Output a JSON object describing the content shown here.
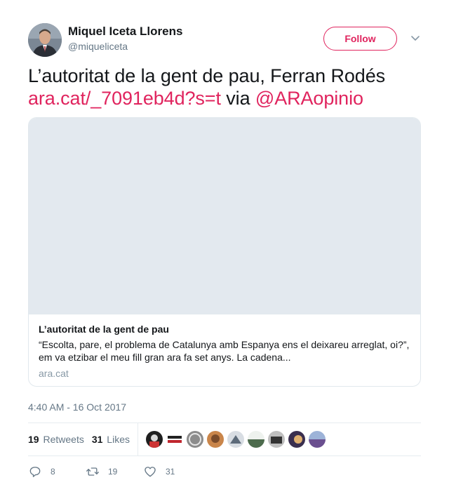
{
  "user": {
    "full_name": "Miquel Iceta Llorens",
    "handle": "@miqueliceta",
    "avatar_icon": "profile-photo"
  },
  "follow_label": "Follow",
  "tweet": {
    "text_plain": "L’autoritat de la gent de pau, Ferran Rodés",
    "link": "ara.cat/_7091eb4d?s=t",
    "via": "via",
    "mention": "@ARAopinio"
  },
  "card": {
    "title": "L’autoritat de la gent de pau",
    "description": "“Escolta, pare, el problema de Catalunya amb Espanya ens el deixareu arreglat, oi?”, em va etzibar el meu fill gran ara fa set anys. La cadena...",
    "domain": "ara.cat"
  },
  "timestamp": "4:40 AM - 16 Oct 2017",
  "stats": {
    "retweets_count": "19",
    "retweets_label": "Retweets",
    "likes_count": "31",
    "likes_label": "Likes"
  },
  "actions": {
    "reply_count": "8",
    "retweet_count": "19",
    "like_count": "31"
  },
  "colors": {
    "accent": "#e0245e",
    "muted": "#657786",
    "border": "#e1e8ed"
  }
}
